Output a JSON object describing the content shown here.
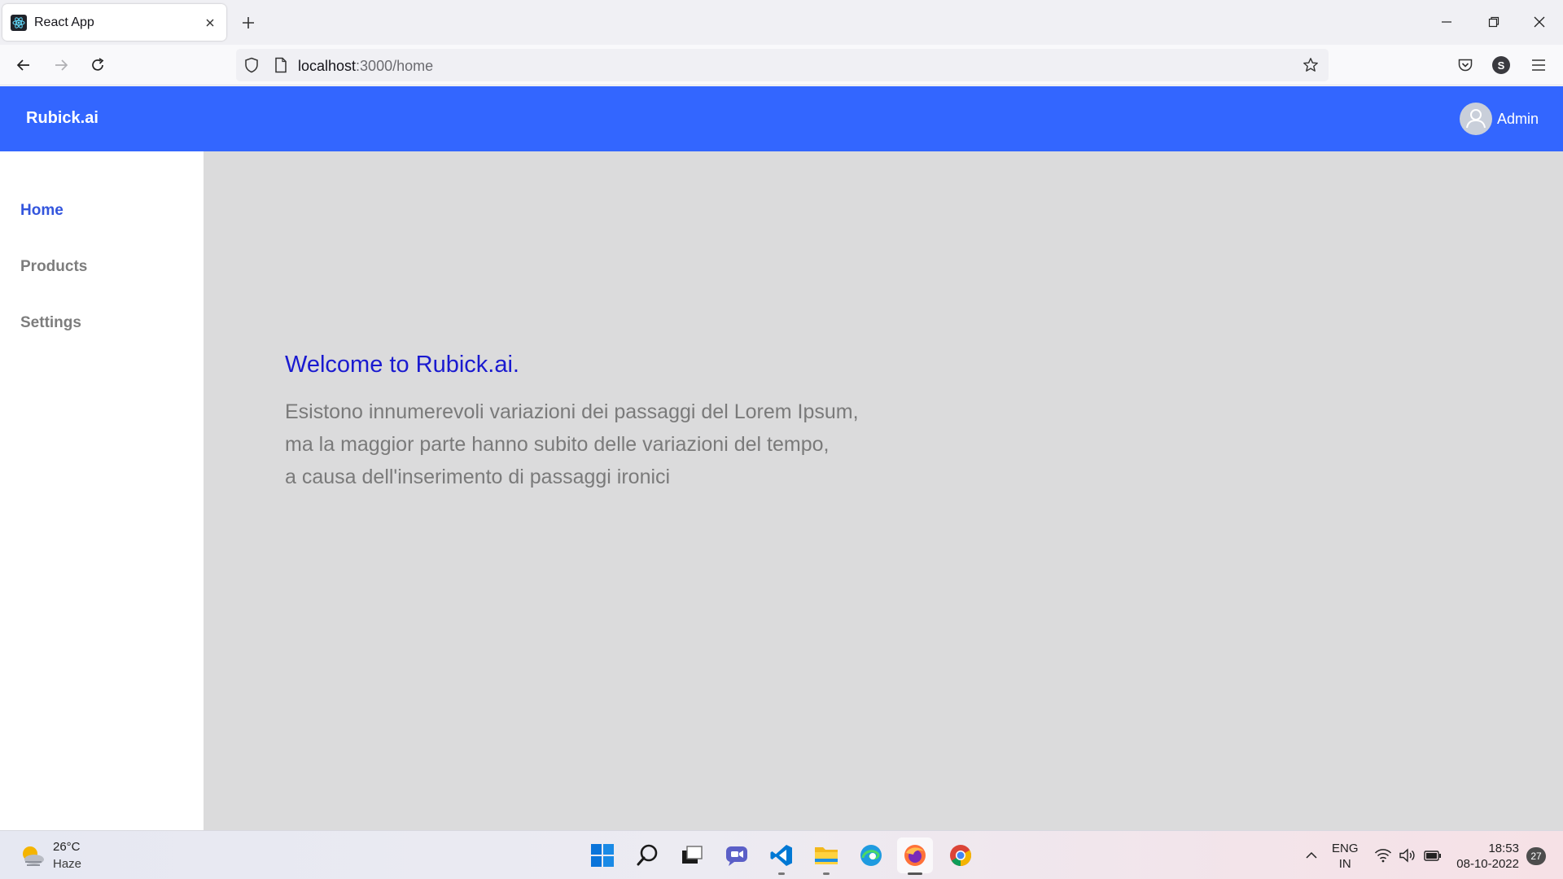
{
  "browser": {
    "tab_title": "React App",
    "url_host": "localhost",
    "url_rest": ":3000/home",
    "profile_initial": "S"
  },
  "app": {
    "brand": "Rubick.ai",
    "user_name": "Admin",
    "accent_color": "#3366ff"
  },
  "sidebar": {
    "items": [
      {
        "label": "Home",
        "active": true
      },
      {
        "label": "Products",
        "active": false
      },
      {
        "label": "Settings",
        "active": false
      }
    ]
  },
  "main": {
    "heading": "Welcome to Rubick.ai.",
    "lines": [
      "Esistono innumerevoli variazioni dei passaggi del Lorem Ipsum,",
      "ma la maggior parte hanno subito delle variazioni del tempo,",
      "a causa dell'inserimento di passaggi ironici"
    ]
  },
  "taskbar": {
    "weather_temp": "26°C",
    "weather_condition": "Haze",
    "apps": [
      "start-icon",
      "search-icon",
      "task-view-icon",
      "chat-icon",
      "vscode-icon",
      "file-explorer-icon",
      "edge-icon",
      "firefox-icon",
      "chrome-icon"
    ],
    "lang_top": "ENG",
    "lang_bottom": "IN",
    "time": "18:53",
    "date": "08-10-2022",
    "notification_count": "27"
  }
}
